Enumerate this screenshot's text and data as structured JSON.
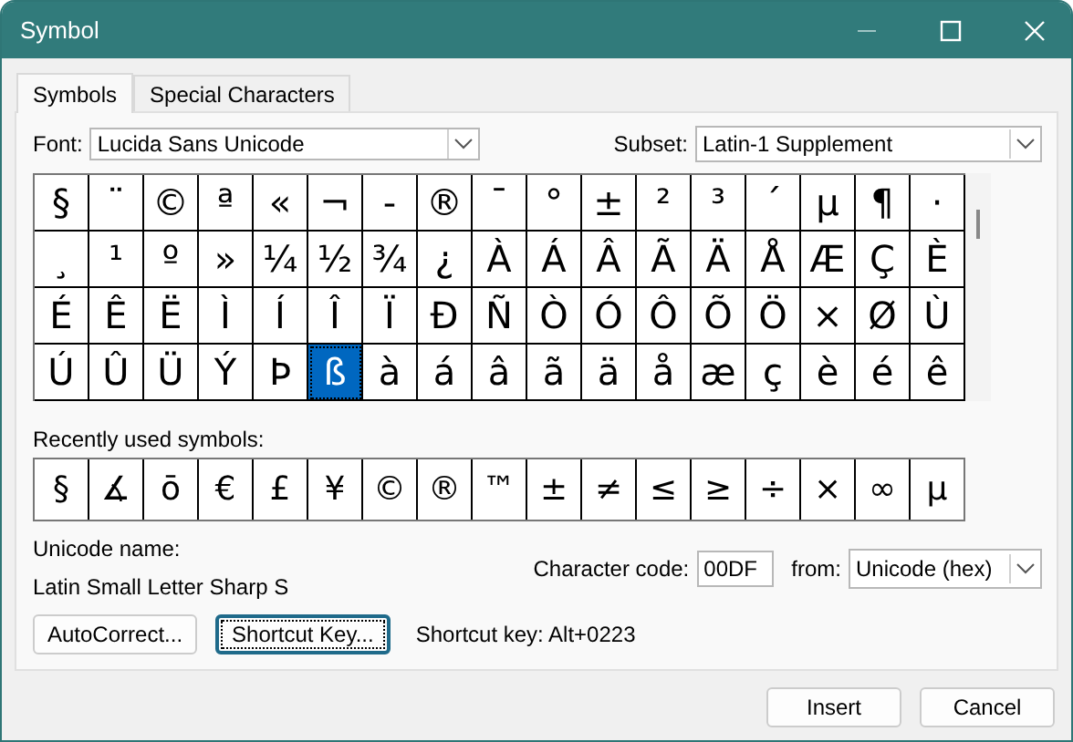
{
  "window": {
    "title": "Symbol"
  },
  "tabs": [
    {
      "label": "Symbols",
      "selected": true
    },
    {
      "label": "Special Characters",
      "selected": false
    }
  ],
  "font": {
    "label": "Font:",
    "value": "Lucida Sans Unicode"
  },
  "subset": {
    "label": "Subset:",
    "value": "Latin-1 Supplement"
  },
  "grid": [
    [
      {
        "c": "§",
        "selected": false
      },
      {
        "c": "¨",
        "selected": false
      },
      {
        "c": "©",
        "selected": false
      },
      {
        "c": "ª",
        "selected": false
      },
      {
        "c": "«",
        "selected": false
      },
      {
        "c": "¬",
        "selected": false
      },
      {
        "c": "-",
        "selected": false
      },
      {
        "c": "®",
        "selected": false
      },
      {
        "c": "¯",
        "selected": false
      },
      {
        "c": "°",
        "selected": false
      },
      {
        "c": "±",
        "selected": false
      },
      {
        "c": "²",
        "selected": false
      },
      {
        "c": "³",
        "selected": false
      },
      {
        "c": "´",
        "selected": false
      },
      {
        "c": "µ",
        "selected": false
      },
      {
        "c": "¶",
        "selected": false
      },
      {
        "c": "·",
        "selected": false
      }
    ],
    [
      {
        "c": "¸",
        "selected": false
      },
      {
        "c": "¹",
        "selected": false
      },
      {
        "c": "º",
        "selected": false
      },
      {
        "c": "»",
        "selected": false
      },
      {
        "c": "¼",
        "selected": false
      },
      {
        "c": "½",
        "selected": false
      },
      {
        "c": "¾",
        "selected": false
      },
      {
        "c": "¿",
        "selected": false
      },
      {
        "c": "À",
        "selected": false
      },
      {
        "c": "Á",
        "selected": false
      },
      {
        "c": "Â",
        "selected": false
      },
      {
        "c": "Ã",
        "selected": false
      },
      {
        "c": "Ä",
        "selected": false
      },
      {
        "c": "Å",
        "selected": false
      },
      {
        "c": "Æ",
        "selected": false
      },
      {
        "c": "Ç",
        "selected": false
      },
      {
        "c": "È",
        "selected": false
      }
    ],
    [
      {
        "c": "É",
        "selected": false
      },
      {
        "c": "Ê",
        "selected": false
      },
      {
        "c": "Ë",
        "selected": false
      },
      {
        "c": "Ì",
        "selected": false
      },
      {
        "c": "Í",
        "selected": false
      },
      {
        "c": "Î",
        "selected": false
      },
      {
        "c": "Ï",
        "selected": false
      },
      {
        "c": "Ð",
        "selected": false
      },
      {
        "c": "Ñ",
        "selected": false
      },
      {
        "c": "Ò",
        "selected": false
      },
      {
        "c": "Ó",
        "selected": false
      },
      {
        "c": "Ô",
        "selected": false
      },
      {
        "c": "Õ",
        "selected": false
      },
      {
        "c": "Ö",
        "selected": false
      },
      {
        "c": "×",
        "selected": false
      },
      {
        "c": "Ø",
        "selected": false
      },
      {
        "c": "Ù",
        "selected": false
      }
    ],
    [
      {
        "c": "Ú",
        "selected": false
      },
      {
        "c": "Û",
        "selected": false
      },
      {
        "c": "Ü",
        "selected": false
      },
      {
        "c": "Ý",
        "selected": false
      },
      {
        "c": "Þ",
        "selected": false
      },
      {
        "c": "ß",
        "selected": true
      },
      {
        "c": "à",
        "selected": false
      },
      {
        "c": "á",
        "selected": false
      },
      {
        "c": "â",
        "selected": false
      },
      {
        "c": "ã",
        "selected": false
      },
      {
        "c": "ä",
        "selected": false
      },
      {
        "c": "å",
        "selected": false
      },
      {
        "c": "æ",
        "selected": false
      },
      {
        "c": "ç",
        "selected": false
      },
      {
        "c": "è",
        "selected": false
      },
      {
        "c": "é",
        "selected": false
      },
      {
        "c": "ê",
        "selected": false
      }
    ]
  ],
  "recent": {
    "label": "Recently used symbols:",
    "symbols": [
      "§",
      "∡",
      "ō",
      "€",
      "£",
      "¥",
      "©",
      "®",
      "™",
      "±",
      "≠",
      "≤",
      "≥",
      "÷",
      "×",
      "∞",
      "µ"
    ]
  },
  "unicode_name": {
    "label": "Unicode name:",
    "value": "Latin Small Letter Sharp S"
  },
  "character_code": {
    "label": "Character code:",
    "value": "00DF"
  },
  "from": {
    "label": "from:",
    "value": "Unicode (hex)"
  },
  "autocorrect_button": {
    "label": "AutoCorrect...",
    "focused": false
  },
  "shortcut_button": {
    "label": "Shortcut Key...",
    "focused": true
  },
  "shortcut_text": "Shortcut key: Alt+0223",
  "insert_button": {
    "label": "Insert",
    "focused": false
  },
  "cancel_button": {
    "label": "Cancel",
    "focused": false
  }
}
